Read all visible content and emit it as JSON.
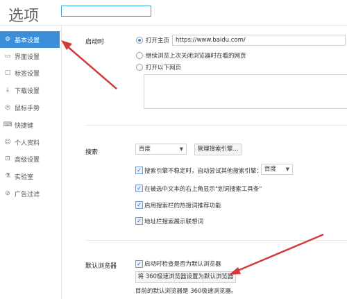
{
  "header": {
    "title": "选项",
    "search_value": ""
  },
  "sidebar": {
    "items": [
      {
        "label": "基本设置",
        "icon": "gear-icon"
      },
      {
        "label": "界面设置",
        "icon": "window-icon"
      },
      {
        "label": "标签设置",
        "icon": "tab-icon"
      },
      {
        "label": "下载设置",
        "icon": "download-icon"
      },
      {
        "label": "鼠标手势",
        "icon": "mouse-icon"
      },
      {
        "label": "快捷键",
        "icon": "keyboard-icon"
      },
      {
        "label": "个人资料",
        "icon": "person-icon"
      },
      {
        "label": "高级设置",
        "icon": "lock-icon"
      },
      {
        "label": "实验室",
        "icon": "lab-icon"
      },
      {
        "label": "广告过滤",
        "icon": "block-icon"
      }
    ]
  },
  "startup": {
    "label": "启动时",
    "option_home": "打开主页",
    "home_url": "https://www.baidu.com/",
    "option_continue": "继续浏览上次关闭浏览器时在看的网页",
    "option_pages": "打开以下网页"
  },
  "search": {
    "label": "搜索",
    "engine": "百度",
    "manage_button": "管理搜索引擎...",
    "fallback_text": "搜索引擎不稳定时，自动尝试其他搜索引擎：",
    "fallback_engine": "百度",
    "opt_selection": "在被选中文本的右上角显示\"划词搜索工具条\"",
    "opt_hotwords": "启用搜索栏的热搜词推荐功能",
    "opt_address": "地址栏搜索展示联想词"
  },
  "default_browser": {
    "label": "默认浏览器",
    "check_on_start": "启动时检查是否为默认浏览器",
    "set_button": "将 360极速浏览器设置为默认浏览器",
    "status": "目前的默认浏览器是 360极速浏览器。"
  },
  "colors": {
    "accent": "#3b8fd9",
    "arrow": "#d33a3a"
  }
}
